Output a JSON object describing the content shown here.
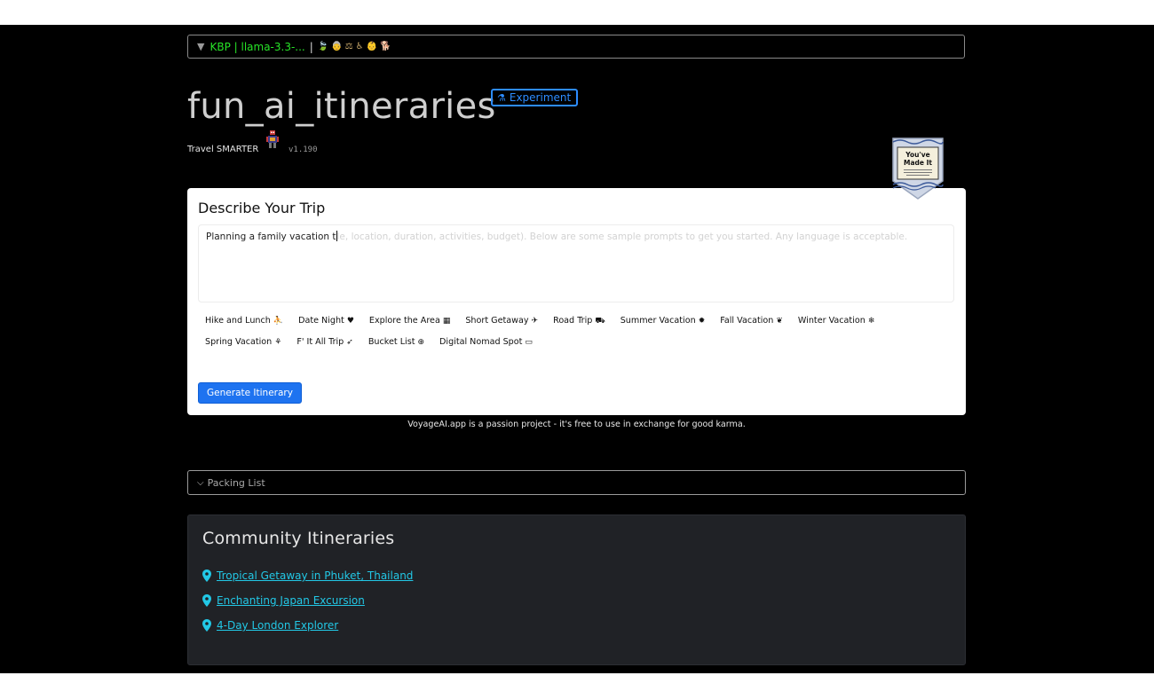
{
  "header": {
    "kbp_prefix": "KBP | llama-3.3-...",
    "kbp_separator": "|",
    "kbp_emojis": "🍃👵⚖♿👶🐕",
    "title": "fun_ai_itineraries",
    "badge_label": "Experiment",
    "tagline": "Travel SMARTER",
    "version": "v1.190"
  },
  "badge_image": {
    "text_line1": "You've",
    "text_line2": "Made It"
  },
  "trip_card": {
    "heading": "Describe Your Trip",
    "prompt_value": "Planning a family vacation t",
    "prompt_placeholder_tail": "le, location, duration, activities, budget). Below are some sample prompts to get you started. Any language is acceptable.",
    "chips": [
      {
        "label": "Hike and Lunch",
        "icon": "hiker-icon",
        "glyph": "⛹"
      },
      {
        "label": "Date Night",
        "icon": "heart-icon",
        "glyph": "♥"
      },
      {
        "label": "Explore the Area",
        "icon": "map-icon",
        "glyph": "▦"
      },
      {
        "label": "Short Getaway",
        "icon": "plane-icon",
        "glyph": "✈"
      },
      {
        "label": "Road Trip",
        "icon": "car-icon",
        "glyph": "⛟"
      },
      {
        "label": "Summer Vacation",
        "icon": "sun-icon",
        "glyph": "✹"
      },
      {
        "label": "Fall Vacation",
        "icon": "leaf-icon",
        "glyph": "❦"
      },
      {
        "label": "Winter Vacation",
        "icon": "snowflake-icon",
        "glyph": "❄"
      },
      {
        "label": "Spring Vacation",
        "icon": "seedling-icon",
        "glyph": "⚘"
      },
      {
        "label": "F' It All Trip",
        "icon": "rocket-icon",
        "glyph": "➶"
      },
      {
        "label": "Bucket List",
        "icon": "globe-icon",
        "glyph": "⊕"
      },
      {
        "label": "Digital Nomad Spot",
        "icon": "laptop-icon",
        "glyph": "▭"
      }
    ],
    "generate_label": "Generate Itinerary"
  },
  "karma_note": "VoyageAI.app is a passion project - it's free to use in exchange for good karma.",
  "packing_label": "Packing List",
  "community": {
    "heading": "Community Itineraries",
    "items": [
      {
        "label": "Tropical Getaway in Phuket, Thailand"
      },
      {
        "label": "Enchanting Japan Excursion"
      },
      {
        "label": "4-Day London Explorer"
      }
    ]
  },
  "colors": {
    "accent_blue": "#1e73f0",
    "badge_blue": "#2d8cff",
    "kbp_green": "#27e427",
    "link_cyan": "#22c8e6"
  }
}
